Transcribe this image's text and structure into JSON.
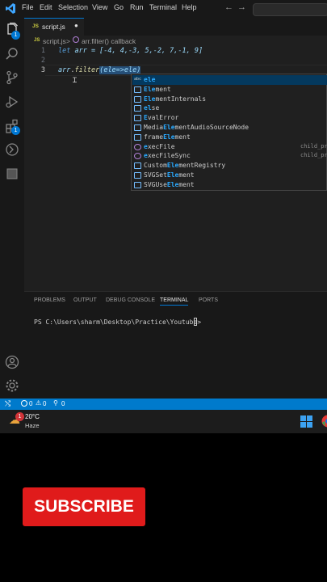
{
  "menu": [
    "File",
    "Edit",
    "Selection",
    "View",
    "Go",
    "Run",
    "Terminal",
    "Help"
  ],
  "activity_badges": {
    "explorer": "1",
    "extensions": "1"
  },
  "tab": {
    "icon": "JS",
    "label": "script.js",
    "modified_dot": "●"
  },
  "breadcrumb": {
    "file_icon": "JS",
    "file": "script.js",
    "sep": ">",
    "symbol": "arr.filter() callback"
  },
  "code": {
    "line_numbers": [
      "1",
      "2",
      "3"
    ],
    "line1_keyword": "let",
    "line1_rest": " arr = [-4, 4,-3, 5,-2, 7,-1, 9]",
    "line3_obj": "arr",
    "line3_dot": ".",
    "line3_method": "filter",
    "line3_args": "(ele=>ele)"
  },
  "suggestions": [
    {
      "pre": "",
      "match": "ele",
      "post": "",
      "kind": "abc",
      "detail": "",
      "selected": true
    },
    {
      "pre": "",
      "match": "Ele",
      "post": "ment",
      "kind": "[⊘]",
      "detail": ""
    },
    {
      "pre": "",
      "match": "Ele",
      "post": "mentInternals",
      "kind": "[⊘]",
      "detail": ""
    },
    {
      "pre": "",
      "match": "el",
      "post": "se",
      "kind": "[⊘]",
      "detail": ""
    },
    {
      "pre": "",
      "match": "E",
      "post": "valError",
      "kind": "[⊘]",
      "detail": ""
    },
    {
      "pre": "Media",
      "match": "Ele",
      "post": "mentAudioSourceNode",
      "kind": "[⊘]",
      "detail": ""
    },
    {
      "pre": "frame",
      "match": "Ele",
      "post": "ment",
      "kind": "[⊘]",
      "detail": ""
    },
    {
      "pre": "",
      "match": "e",
      "post": "xecFile",
      "kind": "fn",
      "detail": "child_pr"
    },
    {
      "pre": "",
      "match": "e",
      "post": "xecFileSync",
      "kind": "fn",
      "detail": "child_pr"
    },
    {
      "pre": "Custom",
      "match": "Ele",
      "post": "mentRegistry",
      "kind": "[⊘]",
      "detail": ""
    },
    {
      "pre": "SVGSet",
      "match": "Ele",
      "post": "ment",
      "kind": "[⊘]",
      "detail": ""
    },
    {
      "pre": "SVGUse",
      "match": "Ele",
      "post": "ment",
      "kind": "[⊘]",
      "detail": ""
    }
  ],
  "panel_tabs": [
    "PROBLEMS",
    "OUTPUT",
    "DEBUG CONSOLE",
    "TERMINAL",
    "PORTS"
  ],
  "terminal": {
    "prompt": "PS C:\\Users\\sharm\\Desktop\\Practice\\Youtube> "
  },
  "statusbar": {
    "errors": "0",
    "warnings": "0",
    "ports": "0"
  },
  "taskbar": {
    "temp": "20°C",
    "weather": "Haze",
    "weather_badge": "1"
  },
  "subscribe_label": "SUBSCRIBE",
  "colors": {
    "accent": "#0078d4",
    "statusbar": "#007acc",
    "subscribe": "#e01b1b",
    "keyword": "#569cd6",
    "method": "#dcdcaa",
    "match": "#2aaaff"
  }
}
